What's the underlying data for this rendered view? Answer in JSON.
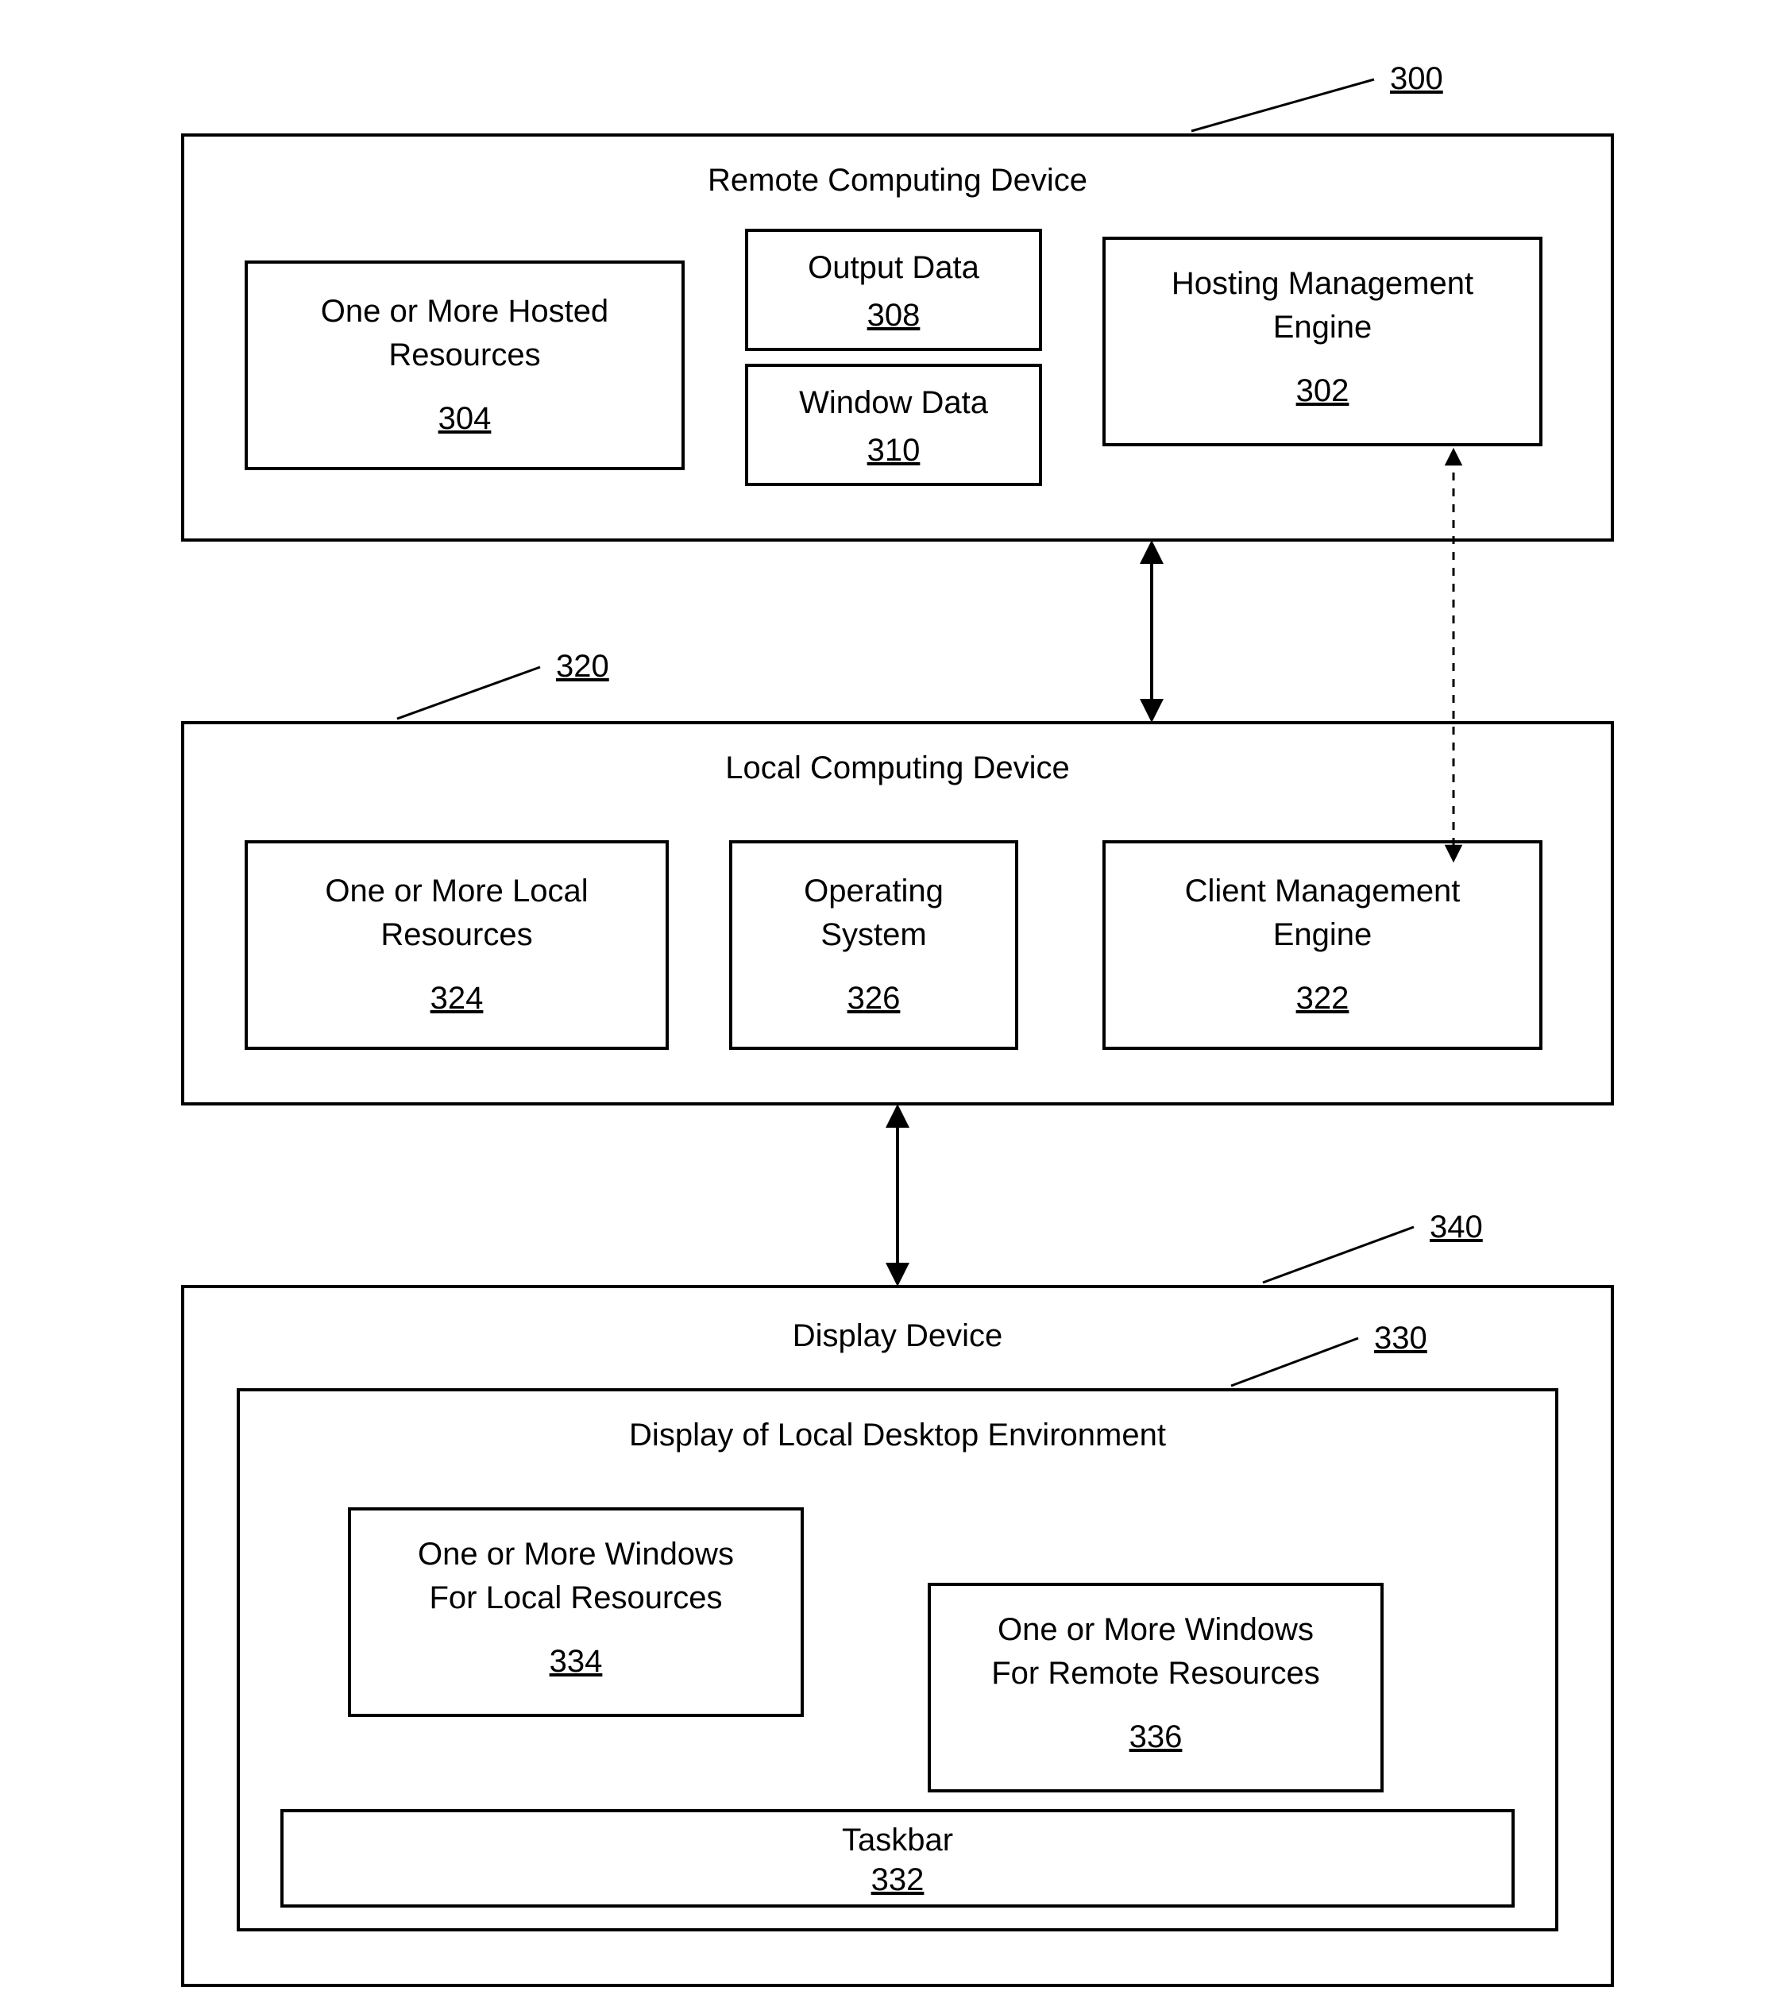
{
  "remote": {
    "ref": "300",
    "title": "Remote Computing Device",
    "hosted": {
      "line1": "One or More Hosted",
      "line2": "Resources",
      "ref": "304"
    },
    "output": {
      "line1": "Output Data",
      "ref": "308"
    },
    "window": {
      "line1": "Window Data",
      "ref": "310"
    },
    "hostmgr": {
      "line1": "Hosting Management",
      "line2": "Engine",
      "ref": "302"
    }
  },
  "local": {
    "ref": "320",
    "title": "Local Computing Device",
    "localres": {
      "line1": "One or More Local",
      "line2": "Resources",
      "ref": "324"
    },
    "os": {
      "line1": "Operating",
      "line2": "System",
      "ref": "326"
    },
    "client": {
      "line1": "Client Management",
      "line2": "Engine",
      "ref": "322"
    }
  },
  "display": {
    "ref": "340",
    "title": "Display Device",
    "desktop": {
      "ref": "330",
      "title": "Display of Local Desktop Environment",
      "winlocal": {
        "line1": "One or More Windows",
        "line2": "For Local Resources",
        "ref": "334"
      },
      "winremote": {
        "line1": "One or More Windows",
        "line2": "For Remote Resources",
        "ref": "336"
      },
      "taskbar": {
        "line1": "Taskbar",
        "ref": "332"
      }
    }
  }
}
